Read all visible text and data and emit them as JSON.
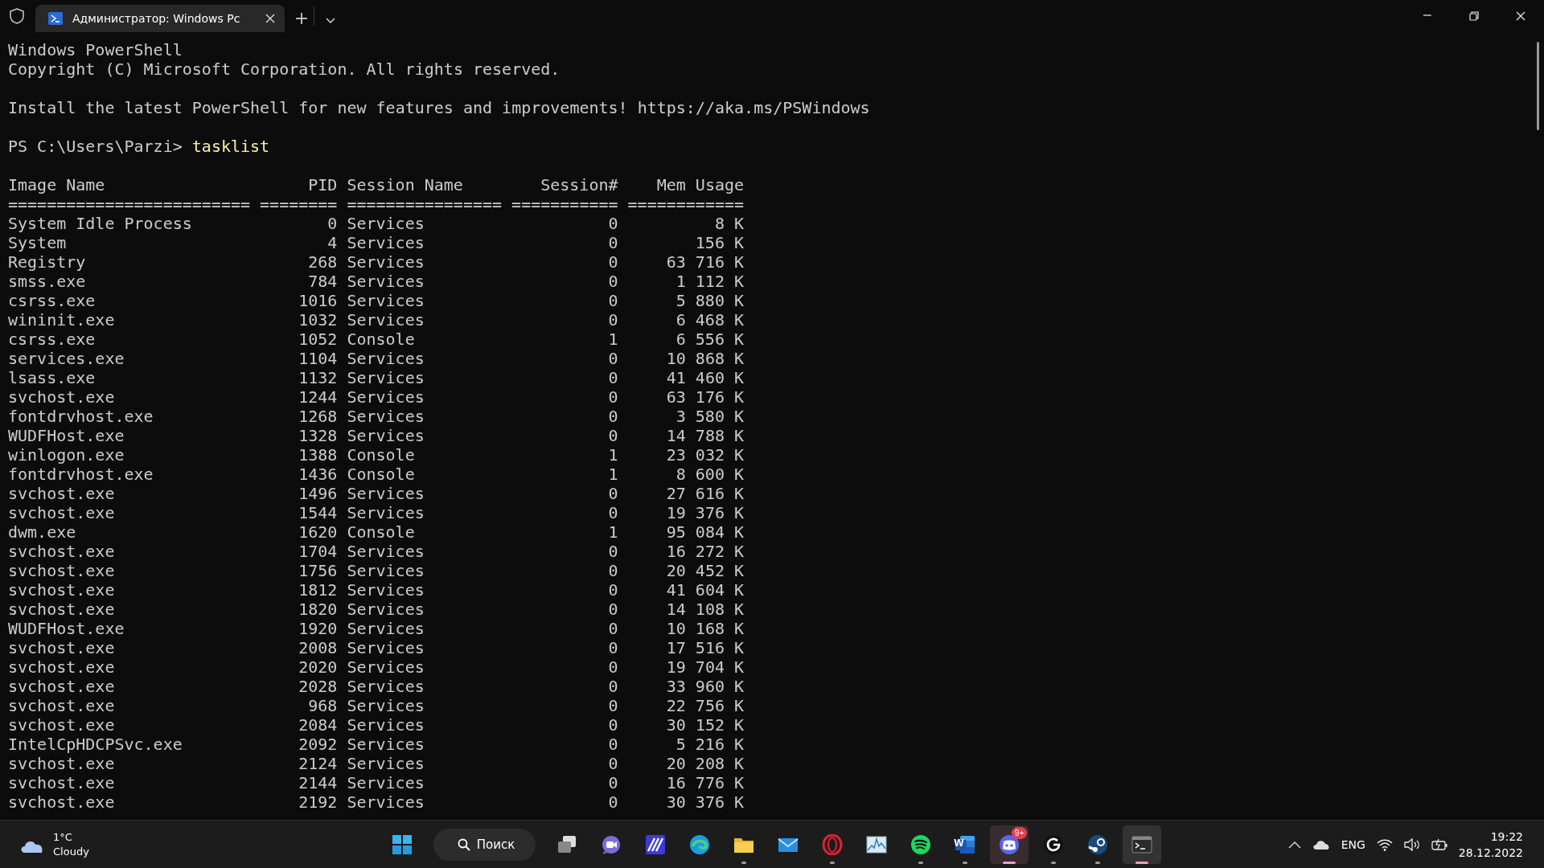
{
  "window": {
    "tabs": [
      {
        "title": "Администратор: Windows Pc",
        "selected": true
      }
    ]
  },
  "console": {
    "banner": [
      "Windows PowerShell",
      "Copyright (C) Microsoft Corporation. All rights reserved."
    ],
    "notice": "Install the latest PowerShell for new features and improvements! https://aka.ms/PSWindows",
    "prompt": "PS C:\\Users\\Parzi>",
    "command": "tasklist"
  },
  "tasklist": {
    "columns": [
      "Image Name",
      "PID",
      "Session Name",
      "Session#",
      "Mem Usage"
    ],
    "separators": [
      "=========================",
      "========",
      "================",
      "===========",
      "============"
    ],
    "rows": [
      [
        "System Idle Process",
        "0",
        "Services",
        "0",
        "8 К"
      ],
      [
        "System",
        "4",
        "Services",
        "0",
        "156 К"
      ],
      [
        "Registry",
        "268",
        "Services",
        "0",
        "63 716 К"
      ],
      [
        "smss.exe",
        "784",
        "Services",
        "0",
        "1 112 К"
      ],
      [
        "csrss.exe",
        "1016",
        "Services",
        "0",
        "5 880 К"
      ],
      [
        "wininit.exe",
        "1032",
        "Services",
        "0",
        "6 468 К"
      ],
      [
        "csrss.exe",
        "1052",
        "Console",
        "1",
        "6 556 К"
      ],
      [
        "services.exe",
        "1104",
        "Services",
        "0",
        "10 868 К"
      ],
      [
        "lsass.exe",
        "1132",
        "Services",
        "0",
        "41 460 К"
      ],
      [
        "svchost.exe",
        "1244",
        "Services",
        "0",
        "63 176 К"
      ],
      [
        "fontdrvhost.exe",
        "1268",
        "Services",
        "0",
        "3 580 К"
      ],
      [
        "WUDFHost.exe",
        "1328",
        "Services",
        "0",
        "14 788 К"
      ],
      [
        "winlogon.exe",
        "1388",
        "Console",
        "1",
        "23 032 К"
      ],
      [
        "fontdrvhost.exe",
        "1436",
        "Console",
        "1",
        "8 600 К"
      ],
      [
        "svchost.exe",
        "1496",
        "Services",
        "0",
        "27 616 К"
      ],
      [
        "svchost.exe",
        "1544",
        "Services",
        "0",
        "19 376 К"
      ],
      [
        "dwm.exe",
        "1620",
        "Console",
        "1",
        "95 084 К"
      ],
      [
        "svchost.exe",
        "1704",
        "Services",
        "0",
        "16 272 К"
      ],
      [
        "svchost.exe",
        "1756",
        "Services",
        "0",
        "20 452 К"
      ],
      [
        "svchost.exe",
        "1812",
        "Services",
        "0",
        "41 604 К"
      ],
      [
        "svchost.exe",
        "1820",
        "Services",
        "0",
        "14 108 К"
      ],
      [
        "WUDFHost.exe",
        "1920",
        "Services",
        "0",
        "10 168 К"
      ],
      [
        "svchost.exe",
        "2008",
        "Services",
        "0",
        "17 516 К"
      ],
      [
        "svchost.exe",
        "2020",
        "Services",
        "0",
        "19 704 К"
      ],
      [
        "svchost.exe",
        "2028",
        "Services",
        "0",
        "33 960 К"
      ],
      [
        "svchost.exe",
        "968",
        "Services",
        "0",
        "22 756 К"
      ],
      [
        "svchost.exe",
        "2084",
        "Services",
        "0",
        "30 152 К"
      ],
      [
        "IntelCpHDCPSvc.exe",
        "2092",
        "Services",
        "0",
        "5 216 К"
      ],
      [
        "svchost.exe",
        "2124",
        "Services",
        "0",
        "20 208 К"
      ],
      [
        "svchost.exe",
        "2144",
        "Services",
        "0",
        "16 776 К"
      ],
      [
        "svchost.exe",
        "2192",
        "Services",
        "0",
        "30 376 К"
      ]
    ]
  },
  "taskbar": {
    "weather": {
      "temperature": "1°C",
      "condition": "Cloudy"
    },
    "search": {
      "label": "Поиск"
    },
    "apps": [
      {
        "kind": "start",
        "running": false,
        "selected": false
      },
      {
        "kind": "search"
      },
      {
        "kind": "taskview",
        "running": false,
        "selected": false
      },
      {
        "kind": "chat",
        "running": false,
        "selected": false
      },
      {
        "kind": "stripes",
        "running": false,
        "selected": false
      },
      {
        "kind": "edge",
        "running": false,
        "selected": false
      },
      {
        "kind": "folder",
        "running": true,
        "selected": false
      },
      {
        "kind": "mail",
        "running": false,
        "selected": false
      },
      {
        "kind": "opera",
        "running": true,
        "selected": false
      },
      {
        "kind": "graph",
        "running": false,
        "selected": false
      },
      {
        "kind": "spotify",
        "running": true,
        "selected": false
      },
      {
        "kind": "word",
        "glyph": "W",
        "running": true,
        "selected": false
      },
      {
        "kind": "discord",
        "badge": "9+",
        "running": true,
        "selected": true
      },
      {
        "kind": "ghub",
        "running": true,
        "selected": false
      },
      {
        "kind": "steam",
        "running": true,
        "selected": false
      },
      {
        "kind": "terminal",
        "running": true,
        "selected": true
      }
    ],
    "tray": {
      "language": "ENG",
      "time": "19:22",
      "date": "28.12.2022"
    }
  }
}
